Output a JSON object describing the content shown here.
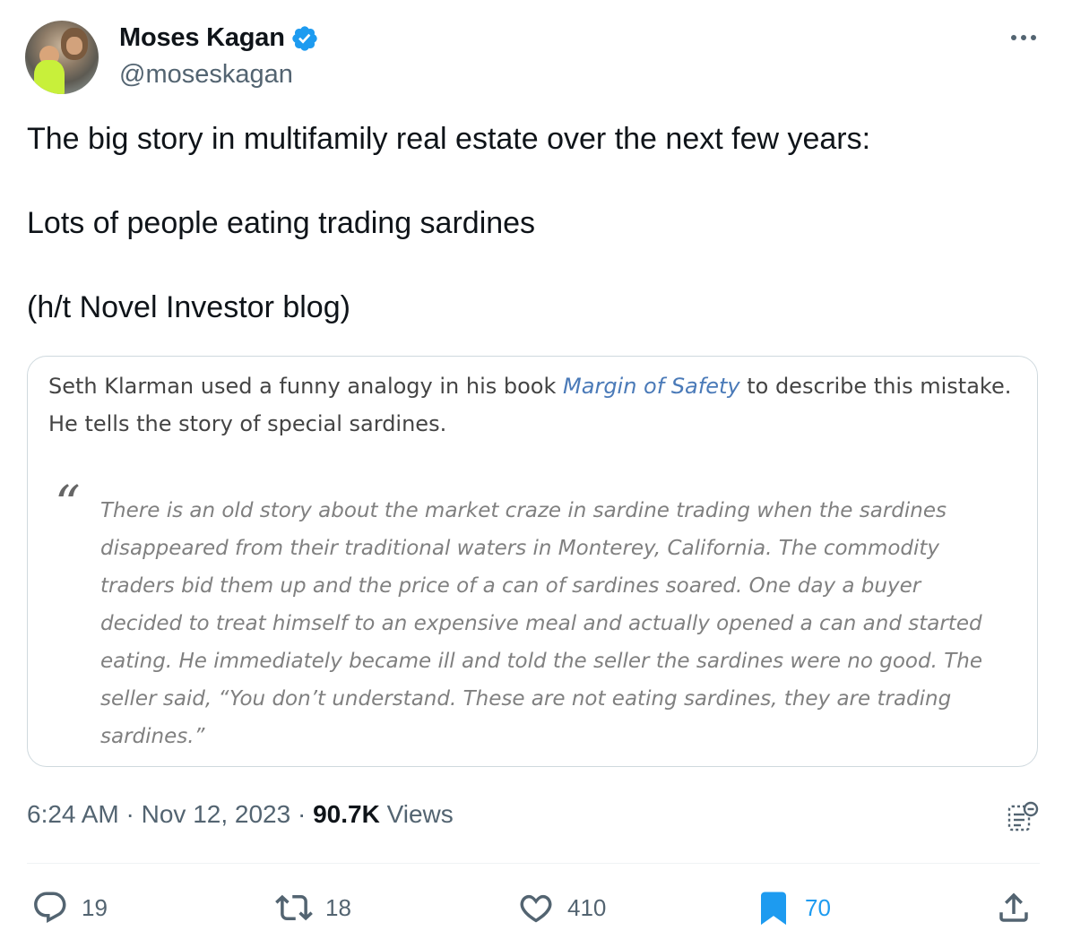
{
  "author": {
    "display_name": "Moses Kagan",
    "handle": "@moseskagan",
    "verified_color": "#1d9bf0"
  },
  "tweet": {
    "lines": [
      "The big story in multifamily real estate over the next few years:",
      "Lots of people eating trading sardines",
      "(h/t Novel Investor blog)"
    ]
  },
  "media": {
    "intro_before": "Seth Klarman used a funny analogy in his book ",
    "intro_book": "Margin of Safety",
    "intro_after": " to describe this mistake. He tells the story of special sardines.",
    "quote_mark": "“",
    "quote": "There is an old story about the market craze in sardine trading when the sardines disappeared from their traditional waters in Monterey, California. The commodity traders bid them up and the price of a can of sardines soared. One day a buyer decided to treat himself to an expensive meal and actually opened a can and started eating. He immediately became ill and told the seller the sardines were no good. The seller said, “You don’t understand. These are not eating sardines, they are trading sardines.”"
  },
  "meta": {
    "time": "6:24 AM",
    "sep1": " · ",
    "date": "Nov 12, 2023",
    "sep2": " · ",
    "views_count": "90.7K",
    "views_label": " Views"
  },
  "actions": {
    "reply_count": "19",
    "retweet_count": "18",
    "like_count": "410",
    "bookmark_count": "70",
    "accent_color": "#1d9bf0",
    "icons": [
      "reply-icon",
      "retweet-icon",
      "like-icon",
      "bookmark-icon",
      "share-icon"
    ]
  }
}
